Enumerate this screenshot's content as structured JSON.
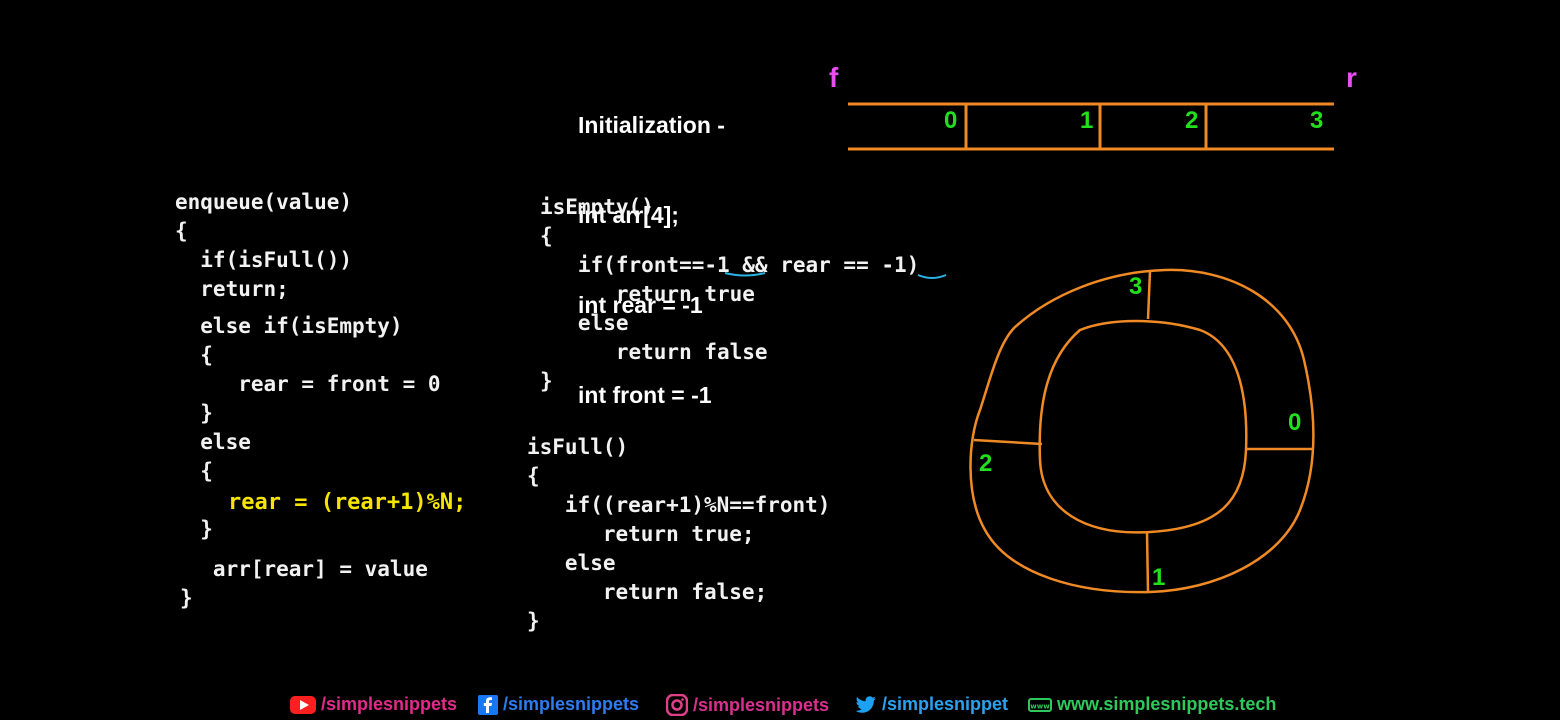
{
  "initialization": {
    "heading": "Initialization -",
    "lines": [
      "int arr[4];",
      "int rear = -1",
      "int front = -1"
    ]
  },
  "array_diagram": {
    "front_label": "f",
    "rear_label": "r",
    "indices": [
      "0",
      "1",
      "2",
      "3"
    ]
  },
  "enqueue": {
    "lines": [
      "enqueue(value)",
      "{",
      "  if(isFull())",
      "  return;",
      "  else if(isEmpty)",
      "  {",
      "     rear = front = 0",
      "  }",
      "  else",
      "  {",
      "    rear = (rear+1)%N;",
      "  }",
      "   arr[rear] = value",
      "}"
    ]
  },
  "is_empty": {
    "lines": [
      "isEmpty()",
      "{",
      "   if(front==-1 && rear == -1)",
      "      return true",
      "   else",
      "      return false",
      "}"
    ]
  },
  "is_full": {
    "lines": [
      "isFull()",
      "{",
      "   if((rear+1)%N==front)",
      "      return true;",
      "   else",
      "      return false;",
      "}"
    ]
  },
  "circular_diagram": {
    "indices": [
      "3",
      "0",
      "2",
      "1"
    ]
  },
  "colors": {
    "code": "#f2f2f2",
    "highlight": "#f5e500",
    "index_green": "#22e01b",
    "pointer_pink": "#e84ff0",
    "diagram_orange": "#f08a24",
    "underline_cyan": "#2ab3e6"
  },
  "footer": {
    "youtube": "/simplesnippets",
    "facebook": "/simplesnippets",
    "instagram": "/simplesnippets",
    "twitter": "/simplesnippet",
    "website": "www.simplesnippets.tech"
  }
}
